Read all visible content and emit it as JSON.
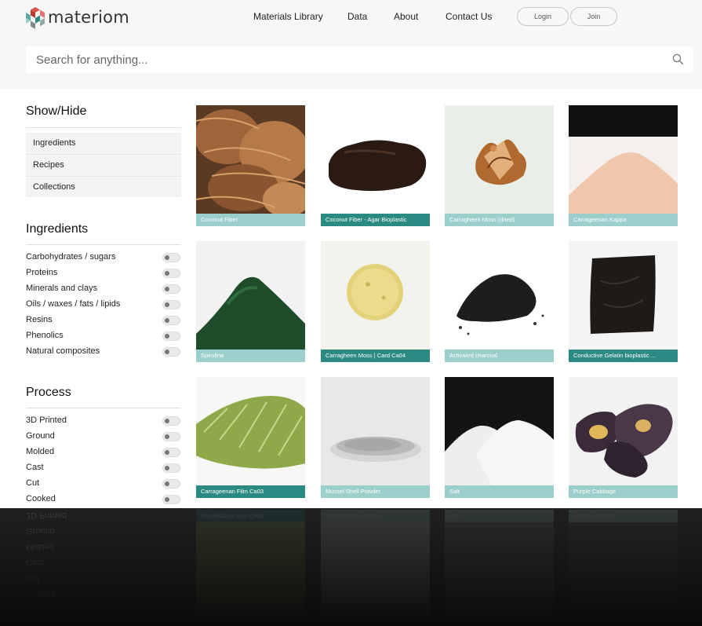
{
  "brand": {
    "name": "materiom"
  },
  "nav": {
    "items": [
      "Materials Library",
      "Data",
      "About",
      "Contact Us"
    ],
    "login_label": "Login",
    "join_label": "Join"
  },
  "search": {
    "placeholder": "Search for anything..."
  },
  "show_hide": {
    "title": "Show/Hide",
    "items": [
      "Ingredients",
      "Recipes",
      "Collections"
    ]
  },
  "ingredients": {
    "title": "Ingredients",
    "items": [
      "Carbohydrates / sugars",
      "Proteins",
      "Minerals and clays",
      "Oils / waxes / fats / lipids",
      "Resins",
      "Phenolics",
      "Natural composites"
    ]
  },
  "process": {
    "title": "Process",
    "items": [
      "3D Printed",
      "Ground",
      "Molded",
      "Cast",
      "Cut",
      "Cooked"
    ]
  },
  "materials": [
    {
      "name": "Coconut Fiber",
      "label_style": "light"
    },
    {
      "name": "Coconut Fiber - Agar Bioplastic",
      "label_style": "dark"
    },
    {
      "name": "Carragheen Moss (dried)",
      "label_style": "light"
    },
    {
      "name": "Carrageenan Kappa",
      "label_style": "light"
    },
    {
      "name": "Spirulina",
      "label_style": "light"
    },
    {
      "name": "Carragheen Moss | Card Ca04",
      "label_style": "dark"
    },
    {
      "name": "Activated charcoal",
      "label_style": "light"
    },
    {
      "name": "Conductive Gelatin bioplastic ...",
      "label_style": "dark"
    },
    {
      "name": "Carrageenan Film Ca03",
      "label_style": "dark"
    },
    {
      "name": "Mussel Shell Powder",
      "label_style": "light"
    },
    {
      "name": "Salt",
      "label_style": "light"
    },
    {
      "name": "Purple Cabbage",
      "label_style": "light"
    }
  ],
  "colors": {
    "label_light": "#9ccfcb",
    "label_dark": "#2b8a82",
    "header_bg": "#f7f7f7"
  },
  "icons": {
    "search": "search-icon",
    "logo": "materiom-hex-logo-icon"
  }
}
